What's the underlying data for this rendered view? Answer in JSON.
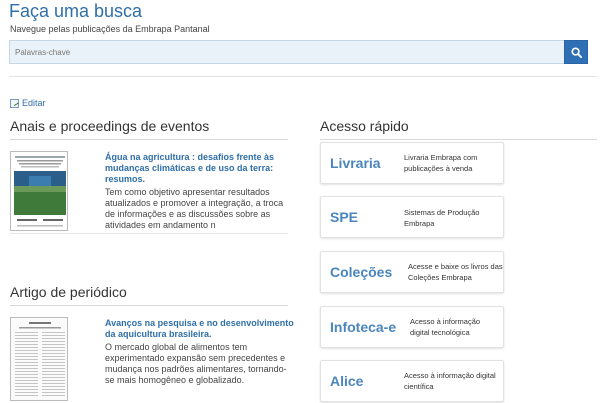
{
  "header": {
    "title": "Faça uma busca",
    "subtitle": "Navegue pelas publicações da Embrapa Pantanal"
  },
  "search": {
    "placeholder": "Palavras-chave",
    "button_icon": "search-icon"
  },
  "edit_link": {
    "label": "Editar",
    "icon": "edit-icon"
  },
  "sections": {
    "anais": {
      "heading": "Anais e proceedings de eventos",
      "item": {
        "title": "Água na agricultura : desafios frente às mudanças climáticas e de uso da terra: resumos.",
        "description": "Tem como objetivo apresentar resultados atualizados e promover a integração, a troca de informações e as discussões sobre as atividades em andamento n"
      }
    },
    "artigo": {
      "heading": "Artigo de periódico",
      "item": {
        "title": "Avanços na pesquisa e no desenvolvimento da aquicultura brasileira.",
        "description": "O mercado global de alimentos tem experimentado expansão sem precedentes e mudança nos padrões alimentares, tornando-se mais homogêneo e globalizado."
      }
    },
    "acesso": {
      "heading": "Acesso rápido",
      "items": [
        {
          "name": "Livraria",
          "description": "Livraria Embrapa com publicações à venda"
        },
        {
          "name": "SPE",
          "description": "Sistemas de Produção Embrapa"
        },
        {
          "name": "Coleções",
          "description": "Acesse e baixe os livros das Coleções Embrapa"
        },
        {
          "name": "Infoteca-e",
          "description": "Acesso à informação digital tecnológica"
        },
        {
          "name": "Alice",
          "description": "Acesso à informação digital científica"
        }
      ]
    }
  },
  "colors": {
    "accent": "#2f6fa8",
    "button": "#2e6fb6",
    "card_name": "#4a86bd"
  }
}
